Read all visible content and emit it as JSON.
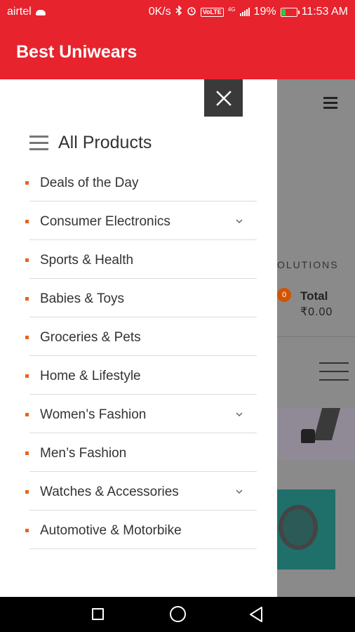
{
  "status_bar": {
    "carrier": "airtel",
    "speed": "0K/s",
    "volte": "VoLTE",
    "network": "4G",
    "battery": "19%",
    "time": "11:53 AM",
    "icons": [
      "cloud-icon",
      "bluetooth-icon",
      "alarm-icon",
      "volte-icon",
      "signal-icon",
      "battery-icon"
    ]
  },
  "app_bar": {
    "title": "Best Uniwears"
  },
  "drawer": {
    "header": "All Products",
    "items": [
      {
        "label": "Deals of the Day",
        "has_submenu": false
      },
      {
        "label": "Consumer Electronics",
        "has_submenu": true
      },
      {
        "label": "Sports & Health",
        "has_submenu": false
      },
      {
        "label": "Babies & Toys",
        "has_submenu": false
      },
      {
        "label": "Groceries & Pets",
        "has_submenu": false
      },
      {
        "label": "Home & Lifestyle",
        "has_submenu": false
      },
      {
        "label": "Women’s Fashion",
        "has_submenu": true
      },
      {
        "label": "Men’s Fashion",
        "has_submenu": false
      },
      {
        "label": "Watches & Accessories",
        "has_submenu": true
      },
      {
        "label": "Automotive & Motorbike",
        "has_submenu": false
      }
    ]
  },
  "background_page": {
    "solutions_text": "OLUTIONS",
    "cart_count": "0",
    "total_label": "Total",
    "total_amount": "₹0.00"
  },
  "colors": {
    "primary": "#e7232d",
    "bullet": "#e8641c",
    "close_bg": "#3a3a3a"
  }
}
